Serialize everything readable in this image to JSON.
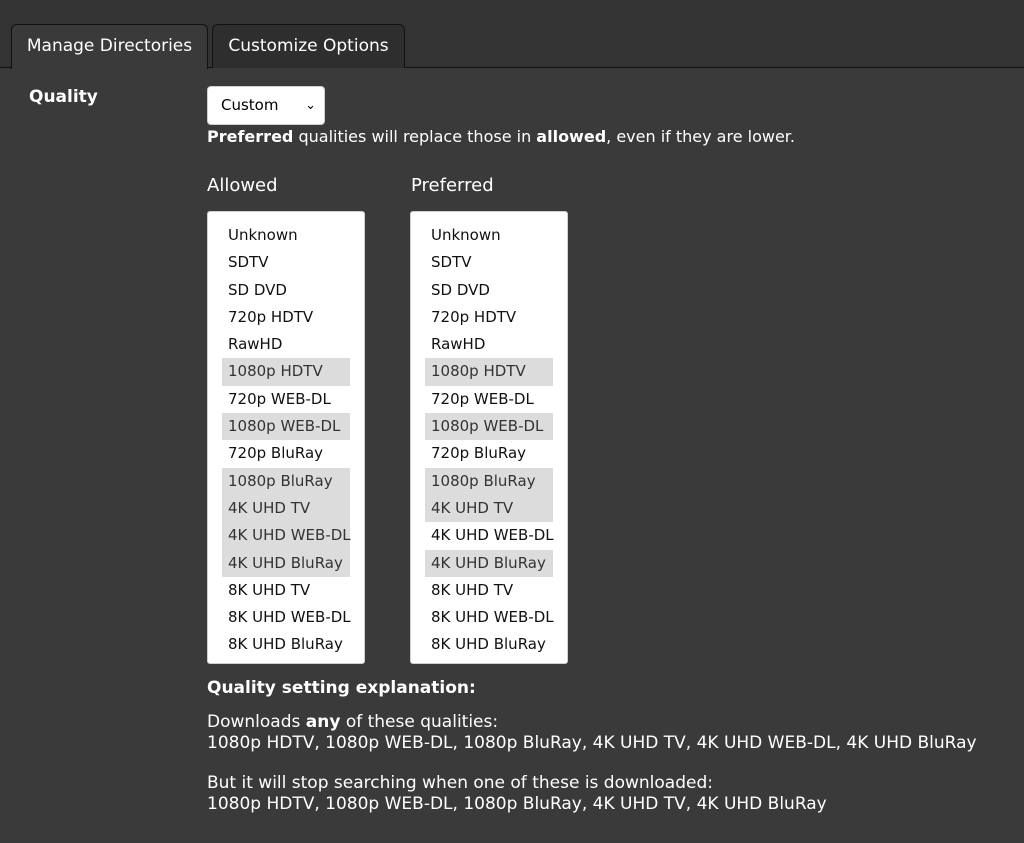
{
  "tabs": [
    {
      "label": "Manage Directories",
      "active": true
    },
    {
      "label": "Customize Options",
      "active": false
    }
  ],
  "quality": {
    "label": "Quality",
    "select_value": "Custom",
    "note_prefix": "Preferred",
    "note_mid": " qualities will replace those in ",
    "note_bold": "allowed",
    "note_suffix": ", even if they are lower."
  },
  "allowed": {
    "title": "Allowed",
    "options": [
      {
        "label": "Unknown",
        "selected": false
      },
      {
        "label": "SDTV",
        "selected": false
      },
      {
        "label": "SD DVD",
        "selected": false
      },
      {
        "label": "720p HDTV",
        "selected": false
      },
      {
        "label": "RawHD",
        "selected": false
      },
      {
        "label": "1080p HDTV",
        "selected": true
      },
      {
        "label": "720p WEB-DL",
        "selected": false
      },
      {
        "label": "1080p WEB-DL",
        "selected": true
      },
      {
        "label": "720p BluRay",
        "selected": false
      },
      {
        "label": "1080p BluRay",
        "selected": true
      },
      {
        "label": "4K UHD TV",
        "selected": true
      },
      {
        "label": "4K UHD WEB-DL",
        "selected": true
      },
      {
        "label": "4K UHD BluRay",
        "selected": true
      },
      {
        "label": "8K UHD TV",
        "selected": false
      },
      {
        "label": "8K UHD WEB-DL",
        "selected": false
      },
      {
        "label": "8K UHD BluRay",
        "selected": false
      }
    ]
  },
  "preferred": {
    "title": "Preferred",
    "options": [
      {
        "label": "Unknown",
        "selected": false
      },
      {
        "label": "SDTV",
        "selected": false
      },
      {
        "label": "SD DVD",
        "selected": false
      },
      {
        "label": "720p HDTV",
        "selected": false
      },
      {
        "label": "RawHD",
        "selected": false
      },
      {
        "label": "1080p HDTV",
        "selected": true
      },
      {
        "label": "720p WEB-DL",
        "selected": false
      },
      {
        "label": "1080p WEB-DL",
        "selected": true
      },
      {
        "label": "720p BluRay",
        "selected": false
      },
      {
        "label": "1080p BluRay",
        "selected": true
      },
      {
        "label": "4K UHD TV",
        "selected": true
      },
      {
        "label": "4K UHD WEB-DL",
        "selected": false
      },
      {
        "label": "4K UHD BluRay",
        "selected": true
      },
      {
        "label": "8K UHD TV",
        "selected": false
      },
      {
        "label": "8K UHD WEB-DL",
        "selected": false
      },
      {
        "label": "8K UHD BluRay",
        "selected": false
      }
    ]
  },
  "explanation": {
    "title": "Quality setting explanation:",
    "line1_prefix": "Downloads ",
    "line1_bold": "any",
    "line1_suffix": " of these qualities:",
    "line1_list": "1080p HDTV, 1080p WEB-DL, 1080p BluRay, 4K UHD TV, 4K UHD WEB-DL, 4K UHD BluRay",
    "line2": "But it will stop searching when one of these is downloaded:",
    "line2_list": "1080p HDTV, 1080p WEB-DL, 1080p BluRay, 4K UHD TV, 4K UHD BluRay"
  },
  "icons": {
    "select_chevron": "chevron-down-icon"
  },
  "colors": {
    "background": "#3a3a3a",
    "selected_option": "#dcdcdc"
  }
}
